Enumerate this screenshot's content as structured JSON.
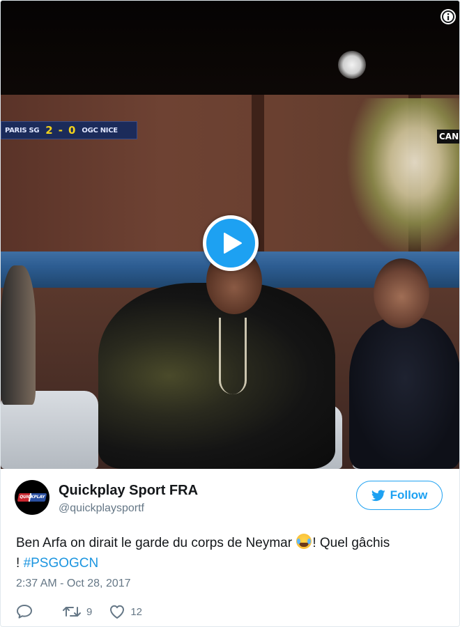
{
  "video": {
    "scoreboard": {
      "home_team": "PARIS SG",
      "home_score": "2",
      "separator": "-",
      "away_score": "0",
      "away_team": "OGC NICE"
    },
    "channel_logo": "CAN"
  },
  "author": {
    "name": "Quickplay Sport FRA",
    "handle": "@quickplaysportf",
    "avatar_text": "QUICKPLAY"
  },
  "follow_button": {
    "label": "Follow"
  },
  "tweet": {
    "text_before_emoji": "Ben Arfa on dirait le garde du corps de Neymar ",
    "emoji": "face-with-tears-of-joy",
    "text_after_emoji": "! Quel gâchis",
    "line2_prefix": "! ",
    "hashtag": "#PSGOGCN"
  },
  "timestamp": "2:37 AM - Oct 28, 2017",
  "actions": {
    "reply_icon": "reply-icon",
    "retweet_count": "9",
    "like_count": "12"
  },
  "colors": {
    "accent": "#1da1f2",
    "hashtag": "#1b95e0",
    "secondary_text": "#657786"
  }
}
